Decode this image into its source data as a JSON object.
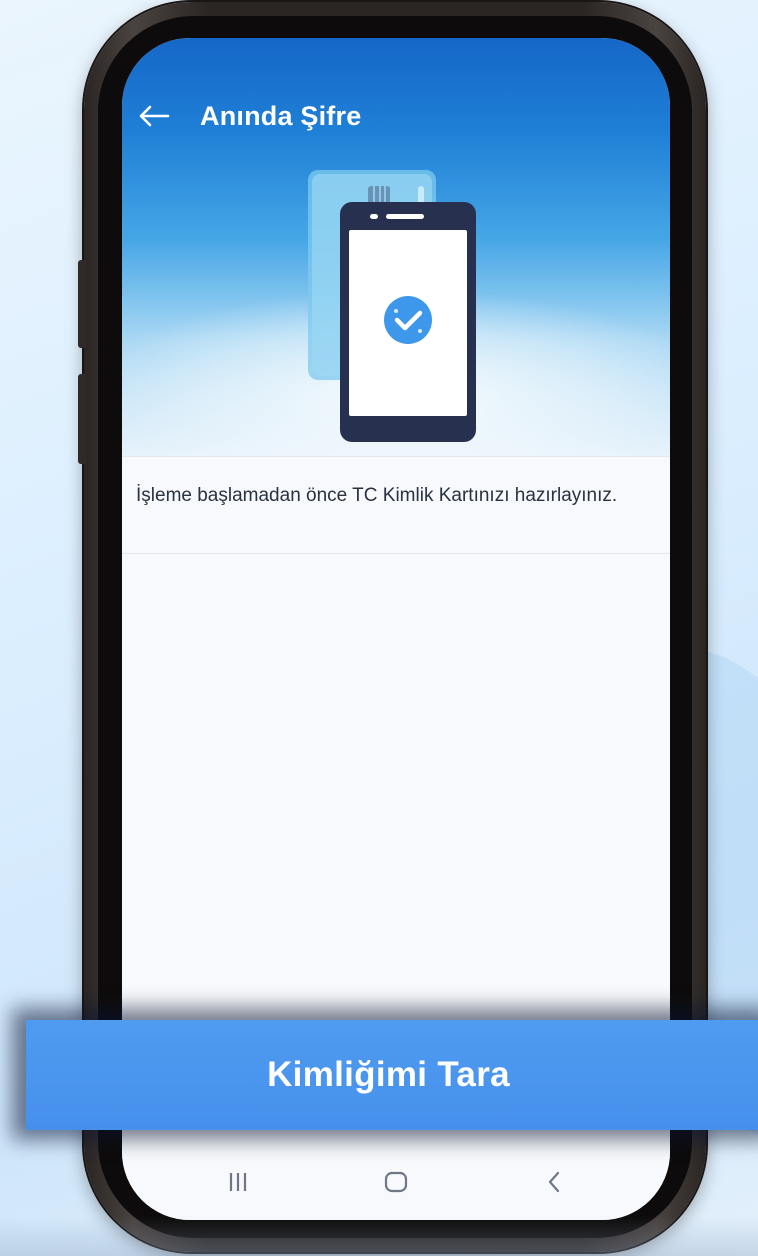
{
  "header": {
    "title": "Anında Şifre",
    "back_icon": "arrow-left-icon"
  },
  "illustration": {
    "description_icons": [
      "id-card-icon",
      "smartphone-icon",
      "check-circle-icon"
    ],
    "accent_color": "#3d97ea",
    "device_color": "#27304f"
  },
  "instruction": {
    "text": "İşleme başlamadan önce TC Kimlik Kartınızı hazırlayınız."
  },
  "cta": {
    "label": "Kimliğimi Tara",
    "color": "#4a94ee"
  },
  "system_nav": {
    "recents_icon": "recents-icon",
    "home_icon": "home-icon",
    "back_icon": "back-chevron-icon"
  },
  "colors": {
    "header_top": "#1667c7",
    "screen_background": "#f7f9fc",
    "text": "#2a3140"
  }
}
